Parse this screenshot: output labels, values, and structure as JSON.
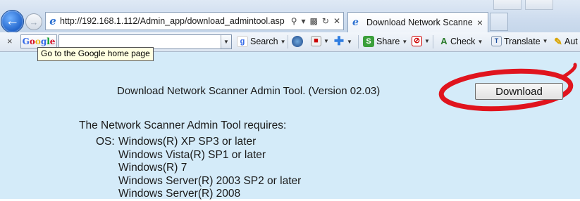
{
  "browser": {
    "address_url": "http://192.168.1.112/Admin_app/download_admintool.asp",
    "tab_title": "Download Network Scanne...",
    "tab_close": "×"
  },
  "google_toolbar": {
    "close": "×",
    "logo": [
      "G",
      "o",
      "o",
      "g",
      "l",
      "e"
    ],
    "search_value": "",
    "tooltip": "Go to the Google home page",
    "items": {
      "search": "Search",
      "share": "Share",
      "check": "Check",
      "translate": "Translate",
      "auto": "Aut"
    }
  },
  "page": {
    "title": "Download Network Scanner Admin Tool. (Version 02.03)",
    "download_button": "Download",
    "requirements_intro": "The Network Scanner Admin Tool requires:",
    "os_label": "OS:",
    "os_list": [
      "Windows(R) XP SP3 or later",
      "Windows Vista(R) SP1 or later",
      "Windows(R) 7",
      "Windows Server(R) 2003 SP2 or later",
      "Windows Server(R) 2008"
    ]
  },
  "colors": {
    "page_bg": "#d4ebf9",
    "highlight_ellipse": "#e0141e",
    "back_button": "#1f62c9"
  }
}
